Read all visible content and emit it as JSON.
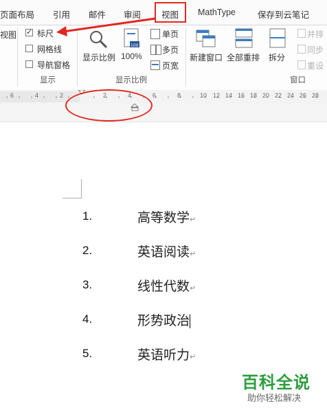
{
  "tabs": [
    {
      "label": "页面布局"
    },
    {
      "label": "引用"
    },
    {
      "label": "邮件"
    },
    {
      "label": "审阅"
    },
    {
      "label": "视图"
    },
    {
      "label": "MathType"
    },
    {
      "label": "保存到云笔记"
    }
  ],
  "ribbon": {
    "views_group_label_partial": "视图",
    "show": {
      "ruler": {
        "label": "标尺",
        "checked": true
      },
      "gridlines": {
        "label": "网格线",
        "checked": false
      },
      "nav_pane": {
        "label": "导航窗格",
        "checked": false
      },
      "group_label": "显示"
    },
    "zoom": {
      "zoom_label": "显示比例",
      "hundred_label": "100%",
      "one_page": "单页",
      "multi_page": "多页",
      "page_width": "页宽",
      "group_label": "显示比例"
    },
    "window": {
      "new_window": "新建窗口",
      "arrange_all": "全部重排",
      "split": "拆分",
      "side_by_side": "并排",
      "sync_scroll": "同步",
      "reset_position": "重设",
      "group_label": "窗口"
    }
  },
  "ruler": {
    "ticks": [
      "6",
      "4",
      "2",
      "2",
      "4",
      "6",
      "8",
      "10",
      "12",
      "14",
      "16",
      "18",
      "20",
      "22",
      "24",
      "26",
      "28"
    ]
  },
  "document": {
    "list": [
      {
        "num": "1.",
        "text": "高等数学"
      },
      {
        "num": "2.",
        "text": "英语阅读"
      },
      {
        "num": "3.",
        "text": "线性代数"
      },
      {
        "num": "4.",
        "text": "形势政治"
      },
      {
        "num": "5.",
        "text": "英语听力"
      }
    ],
    "para_mark": "↵"
  },
  "watermark": {
    "main": "百科全说",
    "sub": "助你轻松解决"
  },
  "colors": {
    "annotation_red": "#e0271f",
    "watermark_green": "#2c9d3e"
  }
}
